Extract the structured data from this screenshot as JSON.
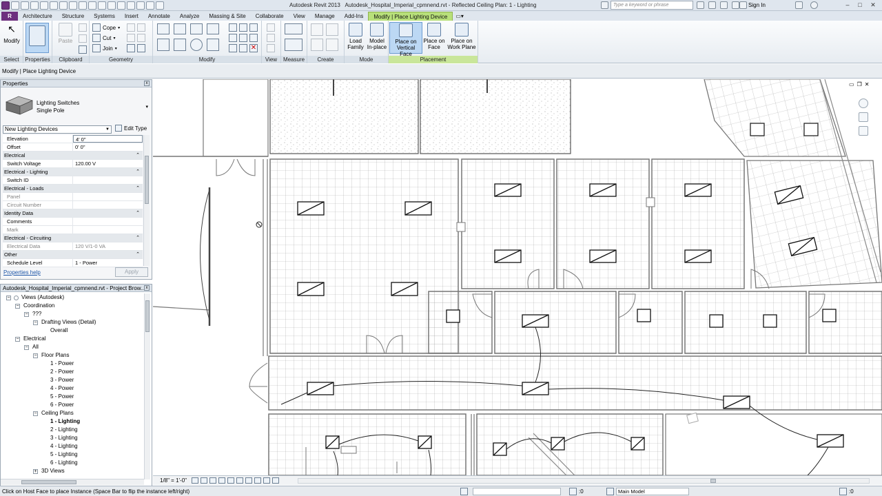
{
  "window": {
    "app_title": "Autodesk Revit 2013",
    "doc_title": "Autodesk_Hospital_Imperial_cpmnend.rvt - Reflected Ceiling Plan: 1 - Lighting",
    "search_placeholder": "Type a keyword or phrase",
    "sign_in": "Sign In",
    "minimize": "–",
    "maximize": "□",
    "close": "✕"
  },
  "ribbon_tabs": [
    "Architecture",
    "Structure",
    "Systems",
    "Insert",
    "Annotate",
    "Analyze",
    "Massing & Site",
    "Collaborate",
    "View",
    "Manage",
    "Add-Ins",
    "Modify | Place Lighting Device"
  ],
  "ribbon": {
    "select": {
      "title": "Select",
      "modify": "Modify"
    },
    "properties": {
      "title": "Properties"
    },
    "clipboard": {
      "title": "Clipboard",
      "paste": "Paste"
    },
    "geometry": {
      "title": "Geometry",
      "cope": "Cope",
      "cut": "Cut",
      "join": "Join"
    },
    "modify": {
      "title": "Modify"
    },
    "view": {
      "title": "View"
    },
    "measure": {
      "title": "Measure"
    },
    "create": {
      "title": "Create"
    },
    "mode": {
      "title": "Mode",
      "load_family_1": "Load",
      "load_family_2": "Family",
      "model_inplace_1": "Model",
      "model_inplace_2": "In-place"
    },
    "placement": {
      "title": "Placement",
      "vertical_1": "Place on",
      "vertical_2": "Vertical Face",
      "face_1": "Place on",
      "face_2": "Face",
      "workplane_1": "Place on",
      "workplane_2": "Work Plane"
    }
  },
  "context_bar": "Modify | Place Lighting Device",
  "properties": {
    "title": "Properties",
    "type_line1": "Lighting Switches",
    "type_line2": "Single Pole",
    "filter": "New Lighting Devices",
    "edit_type": "Edit Type",
    "rows": [
      {
        "k": "Elevation",
        "v": "4'  0\"",
        "kind": "sel"
      },
      {
        "k": "Offset",
        "v": "0'  0\"",
        "kind": "normal"
      },
      {
        "k": "Electrical",
        "v": "",
        "kind": "group"
      },
      {
        "k": "Switch Voltage",
        "v": "120.00 V",
        "kind": "normal"
      },
      {
        "k": "Electrical - Lighting",
        "v": "",
        "kind": "group"
      },
      {
        "k": "Switch ID",
        "v": "",
        "kind": "normal"
      },
      {
        "k": "Electrical - Loads",
        "v": "",
        "kind": "group"
      },
      {
        "k": "Panel",
        "v": "",
        "kind": "gray"
      },
      {
        "k": "Circuit Number",
        "v": "",
        "kind": "gray"
      },
      {
        "k": "Identity Data",
        "v": "",
        "kind": "group"
      },
      {
        "k": "Comments",
        "v": "",
        "kind": "normal"
      },
      {
        "k": "Mark",
        "v": "",
        "kind": "gray"
      },
      {
        "k": "Electrical - Circuiting",
        "v": "",
        "kind": "group"
      },
      {
        "k": "Electrical Data",
        "v": "120 V/1-0 VA",
        "kind": "gray"
      },
      {
        "k": "Other",
        "v": "",
        "kind": "group"
      },
      {
        "k": "Schedule Level",
        "v": "1 - Power",
        "kind": "normal"
      }
    ],
    "help": "Properties help",
    "apply": "Apply"
  },
  "browser": {
    "title": "Autodesk_Hospital_Imperial_cpmnend.rvt - Project Brow...",
    "nodes": [
      {
        "label": "Views (Autodesk)",
        "level": 0,
        "toggle": "−",
        "icon": true
      },
      {
        "label": "Coordination",
        "level": 1,
        "toggle": "−"
      },
      {
        "label": "???",
        "level": 2,
        "toggle": "−"
      },
      {
        "label": "Drafting Views (Detail)",
        "level": 3,
        "toggle": "−"
      },
      {
        "label": "Overall",
        "level": 4,
        "toggle": ""
      },
      {
        "label": "Electrical",
        "level": 1,
        "toggle": "−"
      },
      {
        "label": "All",
        "level": 2,
        "toggle": "−"
      },
      {
        "label": "Floor Plans",
        "level": 3,
        "toggle": "−"
      },
      {
        "label": "1 - Power",
        "level": 4,
        "toggle": ""
      },
      {
        "label": "2 - Power",
        "level": 4,
        "toggle": ""
      },
      {
        "label": "3 - Power",
        "level": 4,
        "toggle": ""
      },
      {
        "label": "4 - Power",
        "level": 4,
        "toggle": ""
      },
      {
        "label": "5 - Power",
        "level": 4,
        "toggle": ""
      },
      {
        "label": "6 - Power",
        "level": 4,
        "toggle": ""
      },
      {
        "label": "Ceiling Plans",
        "level": 3,
        "toggle": "−"
      },
      {
        "label": "1 - Lighting",
        "level": 4,
        "toggle": "",
        "bold": true
      },
      {
        "label": "2 - Lighting",
        "level": 4,
        "toggle": ""
      },
      {
        "label": "3 - Lighting",
        "level": 4,
        "toggle": ""
      },
      {
        "label": "4 - Lighting",
        "level": 4,
        "toggle": ""
      },
      {
        "label": "5 - Lighting",
        "level": 4,
        "toggle": ""
      },
      {
        "label": "6 - Lighting",
        "level": 4,
        "toggle": ""
      },
      {
        "label": "3D Views",
        "level": 3,
        "toggle": "+"
      }
    ]
  },
  "view": {
    "scale": "1/8\" = 1'-0\""
  },
  "status": {
    "message": "Click on Host Face to place Instance (Space Bar to flip the instance left/right)",
    "zero": ":0",
    "model": "Main Model"
  }
}
